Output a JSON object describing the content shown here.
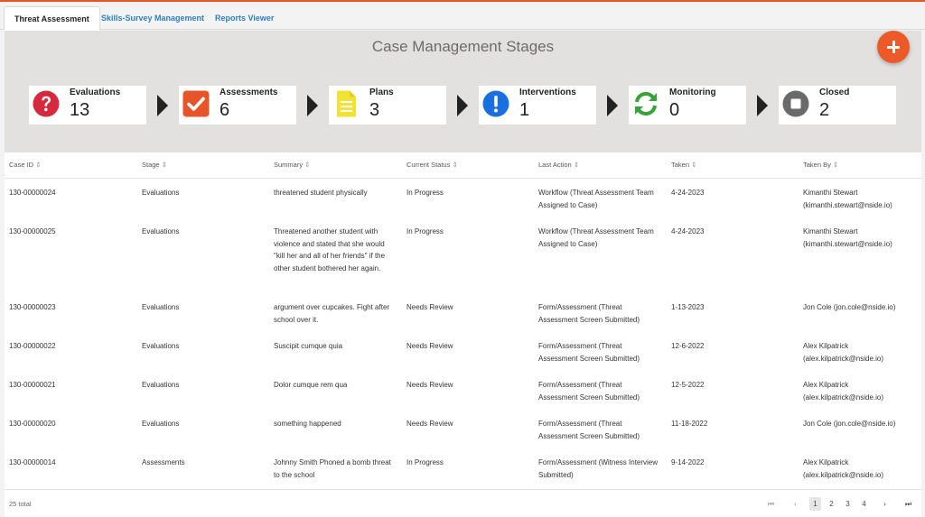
{
  "tabs": [
    "Threat Assessment",
    "Skills-Survey Management",
    "Reports Viewer"
  ],
  "stages": {
    "title": "Case Management Stages",
    "add_icon": "plus-icon",
    "cards": [
      {
        "label": "Evaluations",
        "count": "13",
        "icon": "question-icon",
        "color": "#d6293e"
      },
      {
        "label": "Assessments",
        "count": "6",
        "icon": "check-icon",
        "color": "#e8542a"
      },
      {
        "label": "Plans",
        "count": "3",
        "icon": "document-icon",
        "color": "#f2e233"
      },
      {
        "label": "Interventions",
        "count": "1",
        "icon": "exclamation-icon",
        "color": "#1a6fe0"
      },
      {
        "label": "Monitoring",
        "count": "0",
        "icon": "refresh-icon",
        "color": "#3aa23a"
      },
      {
        "label": "Closed",
        "count": "2",
        "icon": "stop-icon",
        "color": "#6a6a6a"
      }
    ]
  },
  "table": {
    "sort_glyph": "⇕",
    "headers": [
      "Case ID",
      "Stage",
      "Summary",
      "Current Status",
      "Last Action",
      "Taken",
      "Taken By"
    ],
    "rows": [
      [
        "130-00000024",
        "Evaluations",
        "threatened student physically",
        "In Progress",
        "Workflow (Threat Assessment Team Assigned to Case)",
        "4-24-2023",
        "Kimanthi Stewart (kimanthi.stewart@nside.io)"
      ],
      [
        "130-00000025",
        "Evaluations",
        "Threatened another student with violence and stated that she would \"kill her and all of her friends\" if the other student bothered her again.",
        "In Progress",
        "Workflow (Threat Assessment Team Assigned to Case)",
        "4-24-2023",
        "Kimanthi Stewart (kimanthi.stewart@nside.io)"
      ],
      [
        "130-00000023",
        "Evaluations",
        "argument over cupcakes. Fight after school over it.",
        "Needs Review",
        "Form/Assessment (Threat Assessment Screen Submitted)",
        "1-13-2023",
        "Jon Cole (jon.cole@nside.io)"
      ],
      [
        "130-00000022",
        "Evaluations",
        "Suscipit cumque quia",
        "Needs Review",
        "Form/Assessment (Threat Assessment Screen Submitted)",
        "12-6-2022",
        "Alex Kilpatrick (alex.kilpatrick@nside.io)"
      ],
      [
        "130-00000021",
        "Evaluations",
        "Dolor cumque rem qua",
        "Needs Review",
        "Form/Assessment (Threat Assessment Screen Submitted)",
        "12-5-2022",
        "Alex Kilpatrick (alex.kilpatrick@nside.io)"
      ],
      [
        "130-00000020",
        "Evaluations",
        "something happened",
        "Needs Review",
        "Form/Assessment (Threat Assessment Screen Submitted)",
        "11-18-2022",
        "Jon Cole (jon.cole@nside.io)"
      ],
      [
        "130-00000014",
        "Assessments",
        "Johnny Smith Phoned a bomb threat to the school",
        "In Progress",
        "Form/Assessment (Witness Interview Submitted)",
        "9-14-2022",
        "Alex Kilpatrick (alex.kilpatrick@nside.io)"
      ]
    ]
  },
  "footer": {
    "total": "25 total",
    "pages": [
      "1",
      "2",
      "3",
      "4"
    ],
    "active_page": "1",
    "first": "⏮",
    "prev": "‹",
    "next": "›",
    "last": "⏭"
  }
}
